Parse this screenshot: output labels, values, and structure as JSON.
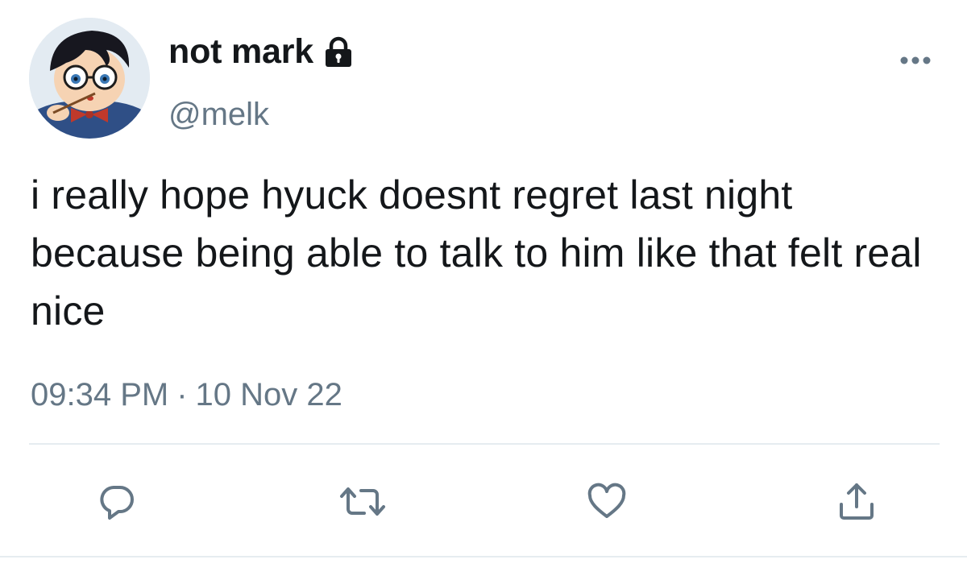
{
  "tweet": {
    "display_name": "not mark",
    "handle": "@melk",
    "text": "i really hope hyuck doesnt regret last night because being able to talk to him like that felt real nice",
    "time": "09:34 PM",
    "separator": "·",
    "date": "10 Nov 22"
  },
  "icons": {
    "lock": "lock-icon",
    "more": "more-icon",
    "reply": "reply-icon",
    "retweet": "retweet-icon",
    "like": "heart-icon",
    "share": "share-icon"
  },
  "colors": {
    "text_primary": "#14171a",
    "text_secondary": "#657786",
    "icon": "#657786",
    "divider": "#e6ecf0"
  }
}
